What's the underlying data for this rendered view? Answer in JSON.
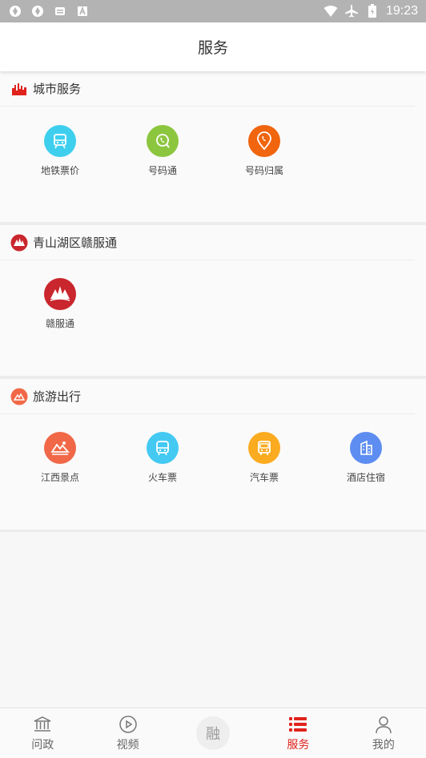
{
  "status_bar": {
    "time": "19:23"
  },
  "header": {
    "title": "服务"
  },
  "sections": [
    {
      "title": "城市服务",
      "items": [
        {
          "label": "地铁票价",
          "icon": "subway-icon",
          "color": "#3fcfee"
        },
        {
          "label": "号码通",
          "icon": "phone-search-icon",
          "color": "#8cc63f"
        },
        {
          "label": "号码归属",
          "icon": "phone-location-icon",
          "color": "#f0650e"
        }
      ]
    },
    {
      "title": "青山湖区赣服通",
      "items": [
        {
          "label": "赣服通",
          "icon": "ganfutong-logo-icon",
          "color": "#c9262d"
        }
      ]
    },
    {
      "title": "旅游出行",
      "items": [
        {
          "label": "江西景点",
          "icon": "scenic-spot-icon",
          "color": "#f16848"
        },
        {
          "label": "火车票",
          "icon": "train-icon",
          "color": "#43c9f2"
        },
        {
          "label": "汽车票",
          "icon": "bus-icon",
          "color": "#fbab1f"
        },
        {
          "label": "酒店住宿",
          "icon": "hotel-icon",
          "color": "#5d8df0"
        }
      ]
    }
  ],
  "nav": {
    "items": [
      {
        "label": "问政",
        "active": false
      },
      {
        "label": "视频",
        "active": false
      },
      {
        "label": "融",
        "active": false
      },
      {
        "label": "服务",
        "active": true
      },
      {
        "label": "我的",
        "active": false
      }
    ]
  },
  "colors": {
    "accent": "#e0231d"
  }
}
